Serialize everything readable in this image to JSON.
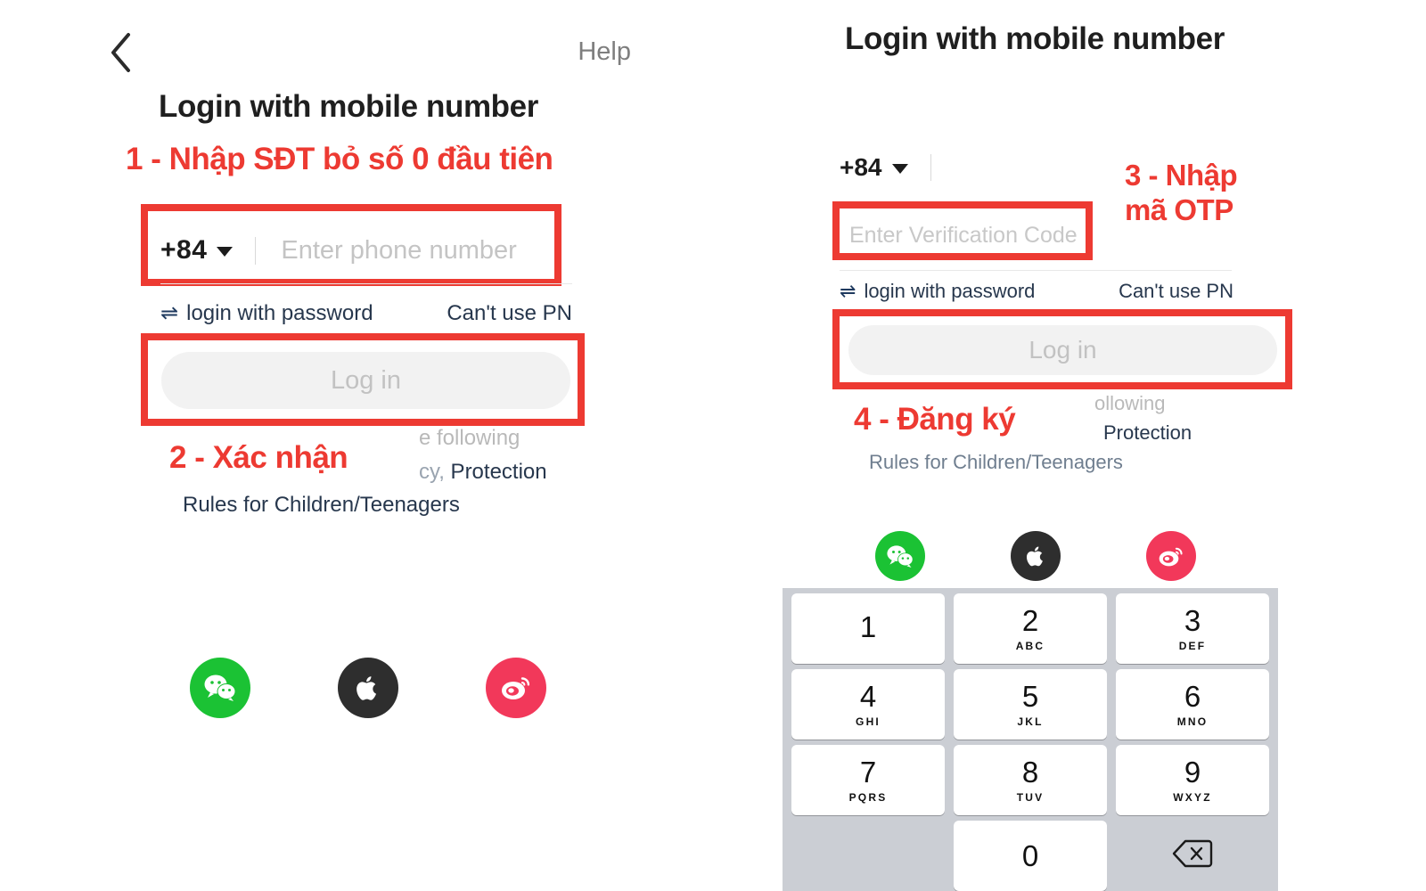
{
  "left_panel": {
    "back_icon": "chevron-left-icon",
    "help_label": "Help",
    "title": "Login with mobile number",
    "country_code": "+84",
    "phone_placeholder": "Enter phone number",
    "switch_icon": "swap-arrows-icon",
    "switch_label": "login with password",
    "cant_use_label": "Can't use PN",
    "login_button": "Log in",
    "terms_fragment_top": "e following",
    "terms_fragment_mid_dim": "cy,",
    "terms_fragment_mid": " Protection",
    "terms_rules": "Rules for Children/Teenagers",
    "annotations": {
      "step1": "1 - Nhập SĐT bỏ số 0 đầu tiên",
      "step2": "2 - Xác nhận"
    }
  },
  "right_panel": {
    "title": "Login with mobile number",
    "country_code": "+84",
    "verification_placeholder": "Enter Verification Code",
    "switch_icon": "swap-arrows-icon",
    "switch_label": "login with password",
    "cant_use_label": "Can't use PN",
    "login_button": "Log in",
    "terms_fragment_top": "ollowing",
    "terms_fragment_mid": "Protection",
    "terms_rules": "Rules for Children/Teenagers",
    "annotations": {
      "step3": "3 - Nhập\nmã OTP",
      "step4": "4 - Đăng ký"
    }
  },
  "socials": [
    {
      "name": "wechat",
      "color": "#1BC234"
    },
    {
      "name": "apple",
      "color": "#2E2E2E"
    },
    {
      "name": "weibo",
      "color": "#F2385A"
    }
  ],
  "keypad": {
    "rows": [
      [
        {
          "num": "1",
          "sub": ""
        },
        {
          "num": "2",
          "sub": "ABC"
        },
        {
          "num": "3",
          "sub": "DEF"
        }
      ],
      [
        {
          "num": "4",
          "sub": "GHI"
        },
        {
          "num": "5",
          "sub": "JKL"
        },
        {
          "num": "6",
          "sub": "MNO"
        }
      ],
      [
        {
          "num": "7",
          "sub": "PQRS"
        },
        {
          "num": "8",
          "sub": "TUV"
        },
        {
          "num": "9",
          "sub": "WXYZ"
        }
      ]
    ],
    "zero": {
      "num": "0",
      "sub": ""
    },
    "delete_icon": "backspace-delete-icon"
  },
  "colors": {
    "annotation_red": "#ED3A32",
    "keypad_bg": "#CBCED4",
    "button_disabled": "#f2f2f2"
  }
}
